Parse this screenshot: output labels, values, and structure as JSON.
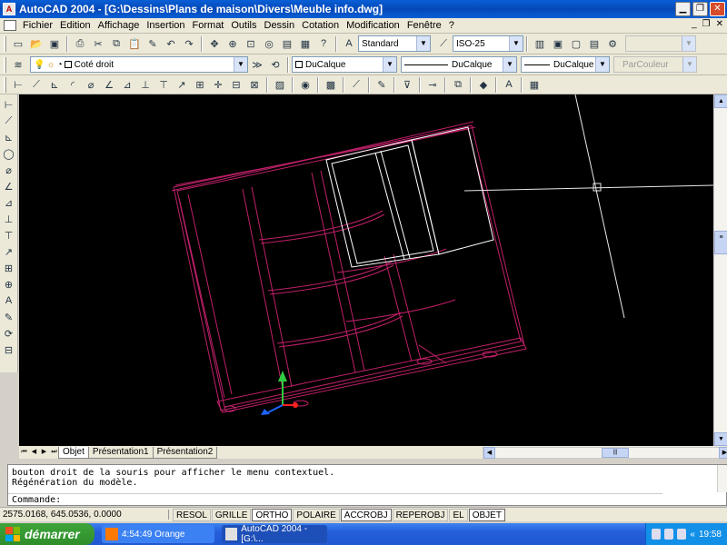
{
  "window": {
    "title": "AutoCAD 2004 - [G:\\Dessins\\Plans de maison\\Divers\\Meuble info.dwg]",
    "app_icon_text": "A"
  },
  "menu": [
    "Fichier",
    "Edition",
    "Affichage",
    "Insertion",
    "Format",
    "Outils",
    "Dessin",
    "Cotation",
    "Modification",
    "Fenêtre",
    "?"
  ],
  "toolbar1": {
    "text_style": "Standard",
    "dim_style": "ISO-25"
  },
  "toolbar2": {
    "layer": "Coté droit",
    "color": "DuCalque",
    "linetype": "DuCalque",
    "lineweight": "DuCalque",
    "plotstyle": "ParCouleur"
  },
  "tabs": [
    "Objet",
    "Présentation1",
    "Présentation2"
  ],
  "command_history": [
    "bouton droit de la souris pour afficher le menu contextuel.",
    "Régénération du modèle."
  ],
  "command_prompt": "Commande:",
  "status": {
    "coords": "2575.0168, 645.0536, 0.0000",
    "buttons": [
      {
        "label": "RESOL",
        "on": false
      },
      {
        "label": "GRILLE",
        "on": false
      },
      {
        "label": "ORTHO",
        "on": true
      },
      {
        "label": "POLAIRE",
        "on": false
      },
      {
        "label": "ACCROBJ",
        "on": true
      },
      {
        "label": "REPEROBJ",
        "on": false
      },
      {
        "label": "EL",
        "on": false
      },
      {
        "label": "OBJET",
        "on": true
      }
    ]
  },
  "taskbar": {
    "start_label": "démarrer",
    "tasks": [
      "4:54:49 Orange",
      "AutoCAD 2004 - [G:\\..."
    ],
    "clock": "19:58"
  },
  "colors": {
    "drawing_bg": "#000000",
    "geometry": "#c0206a",
    "crosshair": "#ffffff",
    "title_bar": "#0a5fd6",
    "taskbar": "#245edb",
    "start_button": "#2f8e2b"
  }
}
